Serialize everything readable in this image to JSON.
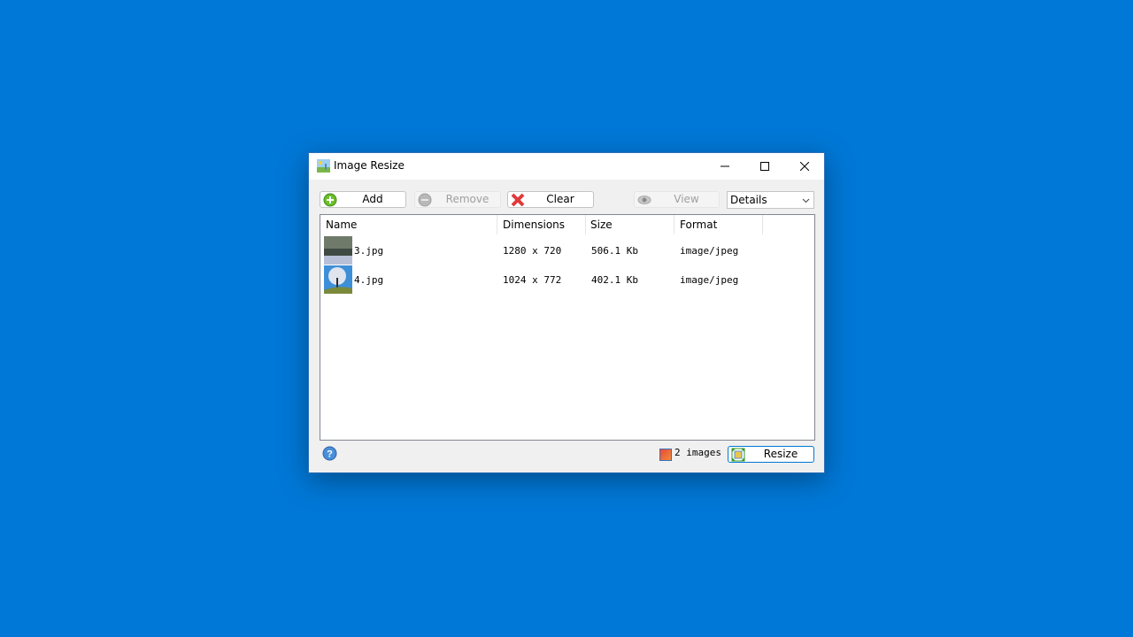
{
  "window": {
    "title": "Image Resize",
    "controls": {
      "minimize": "minimize",
      "maximize": "maximize",
      "close": "close"
    }
  },
  "toolbar": {
    "add_label": "Add",
    "remove_label": "Remove",
    "clear_label": "Clear",
    "view_label": "View",
    "view_mode": "Details"
  },
  "list": {
    "columns": [
      "Name",
      "Dimensions",
      "Size",
      "Format"
    ],
    "rows": [
      {
        "name": "3.jpg",
        "dimensions": "1280 x 720",
        "size": "506.1 Kb",
        "format": "image/jpeg"
      },
      {
        "name": "4.jpg",
        "dimensions": "1024 x 772",
        "size": "402.1 Kb",
        "format": "image/jpeg"
      }
    ]
  },
  "footer": {
    "status": "2 images",
    "resize_label": "Resize"
  }
}
